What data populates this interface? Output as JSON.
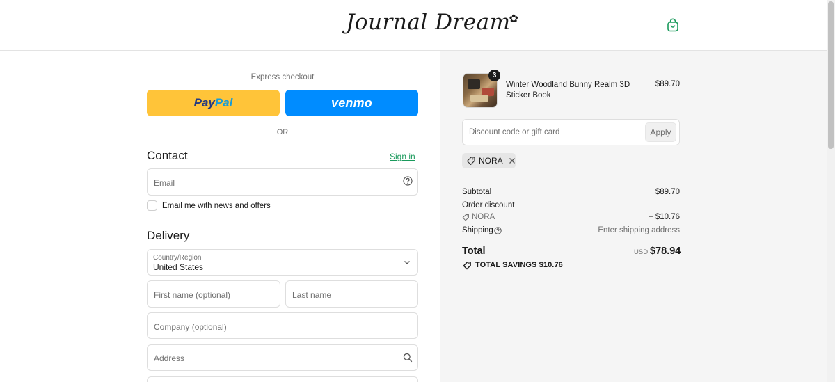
{
  "header": {
    "logo_text": "Journal Dream",
    "logo_flower": "✿"
  },
  "express": {
    "label": "Express checkout",
    "paypal_pay": "Pay",
    "paypal_pal": "Pal",
    "venmo_label": "venmo",
    "or_label": "OR"
  },
  "contact": {
    "title": "Contact",
    "sign_in": "Sign in",
    "email_placeholder": "Email",
    "newsletter_label": "Email me with news and offers"
  },
  "delivery": {
    "title": "Delivery",
    "country_label": "Country/Region",
    "country_value": "United States",
    "first_name_placeholder": "First name (optional)",
    "last_name_placeholder": "Last name",
    "company_placeholder": "Company (optional)",
    "address_placeholder": "Address"
  },
  "summary": {
    "item": {
      "quantity": "3",
      "name": "Winter Woodland Bunny Realm 3D Sticker Book",
      "price": "$89.70"
    },
    "discount_placeholder": "Discount code or gift card",
    "apply_label": "Apply",
    "applied_code": "NORA",
    "subtotal_label": "Subtotal",
    "subtotal_value": "$89.70",
    "order_discount_label": "Order discount",
    "discount_code": "NORA",
    "discount_value": "− $10.76",
    "shipping_label": "Shipping",
    "shipping_value": "Enter shipping address",
    "total_label": "Total",
    "currency": "USD",
    "total_value": "$78.94",
    "savings_label": "TOTAL SAVINGS",
    "savings_value": "$10.76"
  },
  "colors": {
    "paypal": "#ffc439",
    "venmo": "#008cff",
    "link_green": "#1a9a5c",
    "summary_bg": "#f5f5f5"
  }
}
